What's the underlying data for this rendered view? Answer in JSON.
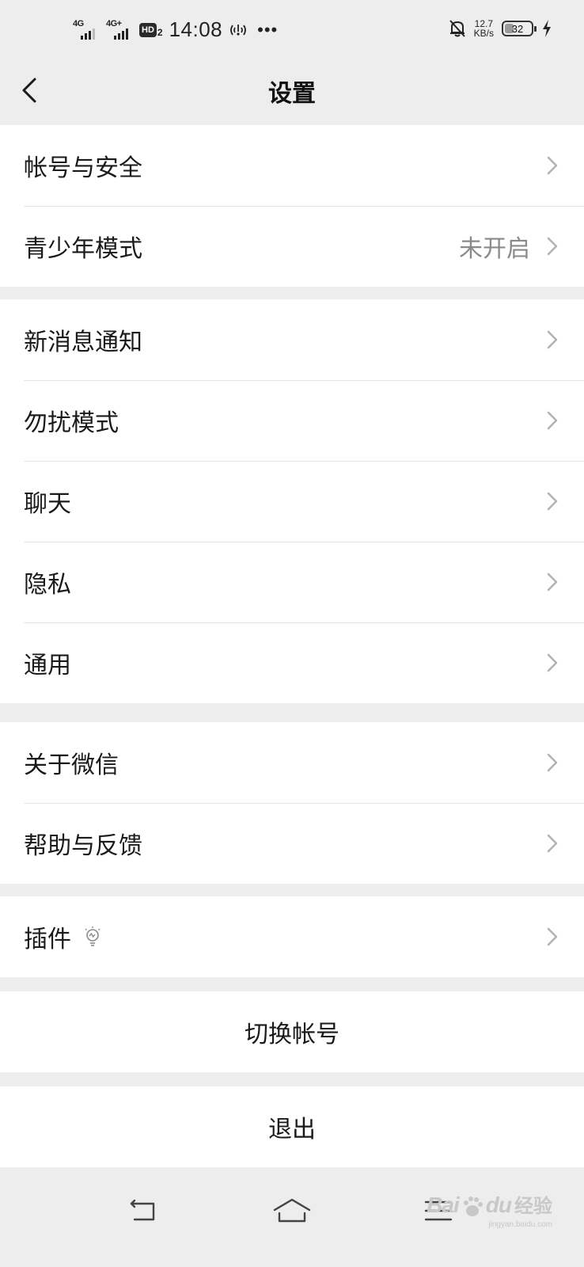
{
  "status_bar": {
    "sim1_label": "4G",
    "sim2_label": "4G+",
    "hd_label": "HD",
    "hd_sub": "2",
    "time": "14:08",
    "more_dots": "•••",
    "net_speed_value": "12.7",
    "net_speed_unit": "KB/s",
    "battery_percent": "32",
    "icons": [
      "signal-icon",
      "hotspot-icon",
      "alarm-off-icon",
      "battery-icon",
      "charging-icon"
    ]
  },
  "nav": {
    "title": "设置",
    "back_icon": "chevron-left-icon"
  },
  "groups": [
    {
      "items": [
        {
          "label": "帐号与安全",
          "value": ""
        },
        {
          "label": "青少年模式",
          "value": "未开启"
        }
      ]
    },
    {
      "items": [
        {
          "label": "新消息通知",
          "value": ""
        },
        {
          "label": "勿扰模式",
          "value": ""
        },
        {
          "label": "聊天",
          "value": ""
        },
        {
          "label": "隐私",
          "value": ""
        },
        {
          "label": "通用",
          "value": ""
        }
      ]
    },
    {
      "items": [
        {
          "label": "关于微信",
          "value": ""
        },
        {
          "label": "帮助与反馈",
          "value": ""
        }
      ]
    },
    {
      "items": [
        {
          "label": "插件",
          "value": "",
          "icon": "lightbulb-icon"
        }
      ]
    }
  ],
  "actions": {
    "switch_account": "切换帐号",
    "logout": "退出"
  },
  "system_nav": {
    "icons": [
      "back-icon",
      "home-icon",
      "menu-icon"
    ]
  },
  "watermark": {
    "logo": "Bai",
    "logo2": "du",
    "brand": "经验",
    "url": "jingyan.baidu.com"
  },
  "colors": {
    "background": "#ededed",
    "card": "#ffffff",
    "text": "#1a1a1a",
    "secondary_text": "#8a8a8a",
    "chevron": "#b2b2b2"
  }
}
